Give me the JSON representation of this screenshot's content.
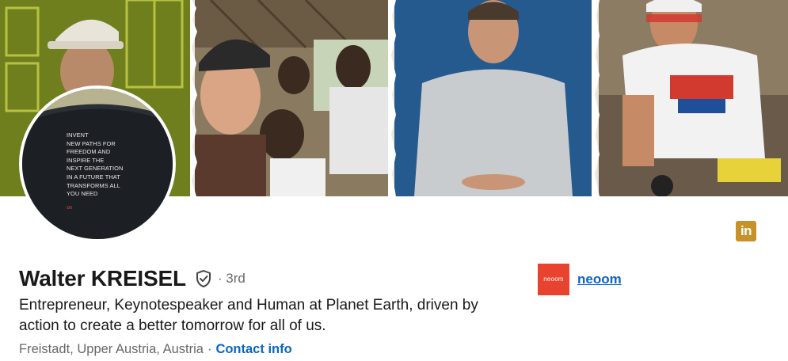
{
  "profile": {
    "name": "Walter KREISEL",
    "degree": "· 3rd",
    "headline": "Entrepreneur, Keynotespeaker and Human at Planet Earth, driven by action to create a better tomorrow for all of us.",
    "location": "Freistadt, Upper Austria, Austria",
    "separator": "·",
    "contact_info_label": "Contact info"
  },
  "avatar": {
    "shirt_lines": [
      "INVENT",
      "NEW PATHS FOR",
      "FREEDOM AND",
      "INSPIRE THE",
      "NEXT GENERATION",
      "IN A FUTURE THAT",
      "TRANSFORMS ALL",
      "YOU NEED"
    ],
    "shirt_logo": "∞"
  },
  "company": {
    "logo_text": "neoom",
    "name": "neoom"
  },
  "badge": {
    "text": "in",
    "color": "#c8922a"
  },
  "colors": {
    "link": "#0a66c2",
    "company_logo_bg": "#e8432e"
  },
  "icons": {
    "verification": "shield-check-icon",
    "linkedin": "linkedin-icon"
  }
}
